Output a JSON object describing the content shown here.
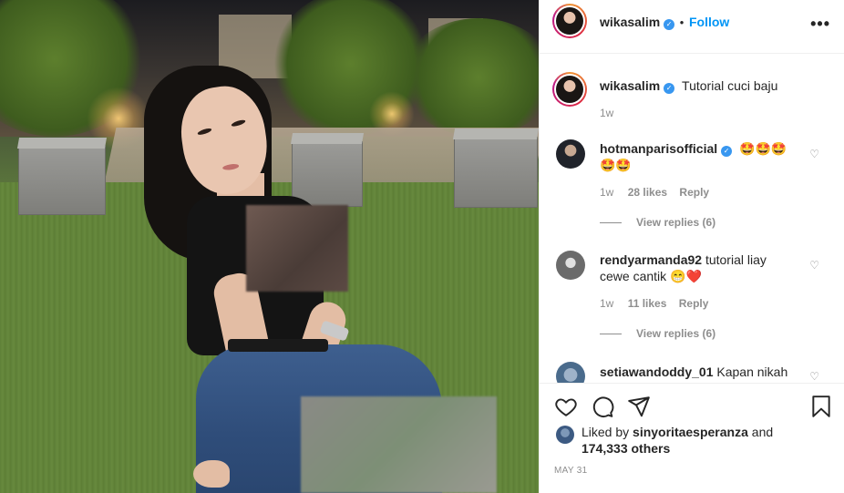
{
  "post": {
    "username": "wikasalim",
    "follow_label": "Follow",
    "separator": "•",
    "caption": "Tutorial cuci baju",
    "caption_time": "1w",
    "more_icon": "more-horizontal-icon"
  },
  "comments": [
    {
      "username": "hotmanparisofficial",
      "verified": true,
      "text": "🤩🤩🤩🤩🤩",
      "time": "1w",
      "likes": "28 likes",
      "reply_label": "Reply",
      "view_replies": "View replies (6)"
    },
    {
      "username": "rendyarmanda92",
      "verified": false,
      "text_line1": "tutorial liay",
      "text_line2": "cewe cantik 😁❤️",
      "time": "1w",
      "likes": "11 likes",
      "reply_label": "Reply",
      "view_replies": "View replies (6)"
    },
    {
      "username": "setiawandoddy_01",
      "verified": false,
      "text": "Kapan nikah"
    }
  ],
  "actions": {
    "like_icon": "heart-outline-icon",
    "comment_icon": "comment-icon",
    "share_icon": "share-icon",
    "save_icon": "bookmark-icon"
  },
  "likes": {
    "prefix": "Liked by",
    "liked_by": "sinyoritaesperanza",
    "connector": "and",
    "count": "174,333 others"
  },
  "date": "MAY 31",
  "colors": {
    "accent": "#0095f6",
    "verified": "#3897f0",
    "muted": "#8e8e8e",
    "text": "#262626"
  }
}
